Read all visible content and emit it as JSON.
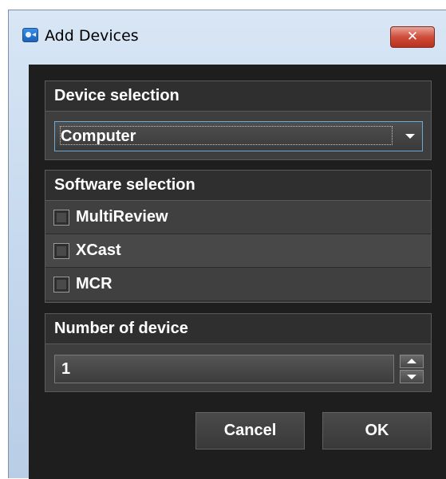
{
  "window": {
    "title": "Add Devices",
    "close_glyph": "✕",
    "icon": "app-camera-icon"
  },
  "device_selection": {
    "header": "Device selection",
    "selected": "Computer"
  },
  "software_selection": {
    "header": "Software selection",
    "items": [
      {
        "label": "MultiReview",
        "checked": false
      },
      {
        "label": "XCast",
        "checked": false
      },
      {
        "label": "MCR",
        "checked": false
      }
    ]
  },
  "number_of_device": {
    "header": "Number of device",
    "value": "1"
  },
  "buttons": {
    "cancel": "Cancel",
    "ok": "OK"
  },
  "colors": {
    "panel_bg": "#1e1e1e",
    "group_bg": "#3e3e3e",
    "focus_border": "#6aa9d8",
    "close_red": "#cf4d3a"
  }
}
